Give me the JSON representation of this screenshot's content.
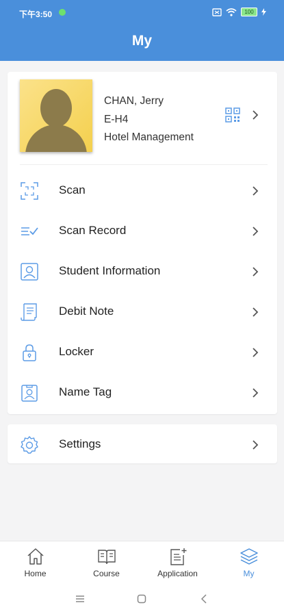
{
  "status_bar": {
    "time": "下午3:50",
    "battery": "100"
  },
  "header": {
    "title": "My"
  },
  "profile": {
    "name": "CHAN, Jerry",
    "class": "E-H4",
    "program": "Hotel Management"
  },
  "menu": [
    {
      "label": "Scan",
      "icon": "scan-icon"
    },
    {
      "label": "Scan Record",
      "icon": "scan-record-icon"
    },
    {
      "label": "Student Information",
      "icon": "student-information-icon"
    },
    {
      "label": "Debit Note",
      "icon": "debit-note-icon"
    },
    {
      "label": "Locker",
      "icon": "lock-icon"
    },
    {
      "label": "Name Tag",
      "icon": "name-tag-icon"
    }
  ],
  "settings": {
    "label": "Settings",
    "icon": "gear-icon"
  },
  "tabbar": {
    "tabs": [
      {
        "label": "Home",
        "icon": "home-icon"
      },
      {
        "label": "Course",
        "icon": "book-icon"
      },
      {
        "label": "Application",
        "icon": "application-icon"
      },
      {
        "label": "My",
        "icon": "my-stack-icon"
      }
    ],
    "active": "My"
  },
  "colors": {
    "primary": "#4a8fdb",
    "icon": "#5b9be6",
    "background": "#f4f4f5"
  }
}
